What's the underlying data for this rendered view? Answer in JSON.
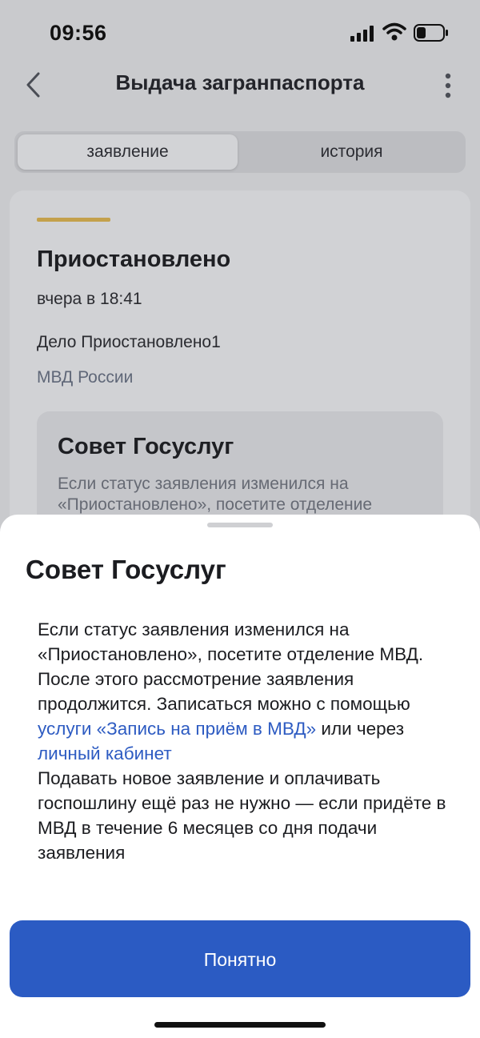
{
  "status_bar": {
    "time": "09:56"
  },
  "header": {
    "title": "Выдача загранпаспорта"
  },
  "tabs": [
    {
      "label": "заявление",
      "active": true
    },
    {
      "label": "история",
      "active": false
    }
  ],
  "card": {
    "status": "Приостановлено",
    "time": "вчера в 18:41",
    "case": "Дело Приостановлено1",
    "org": "МВД России",
    "tip_title": "Совет Госуслуг",
    "tip_text": "Если статус заявления изменился на «Приостановлено», посетите отделение"
  },
  "sheet": {
    "title": "Совет Госуслуг",
    "p1_text": "Если статус заявления изменился на «Приостановлено», посетите отделение МВД. После этого рассмотрение заявления продолжится. Записаться можно с помощью ",
    "p1_link1": "услуги «Запись на приём в МВД»",
    "p1_mid": " или через ",
    "p1_link2": "личный кабинет",
    "p2_text": "Подавать новое заявление и оплачивать госпошлину ещё раз не нужно — если придёте в МВД в течение 6 месяцев со дня подачи заявления",
    "button_label": "Понятно"
  },
  "colors": {
    "primary_button": "#2b5bc3",
    "link": "#2d5bc2",
    "status_accent": "#c4a14c"
  }
}
